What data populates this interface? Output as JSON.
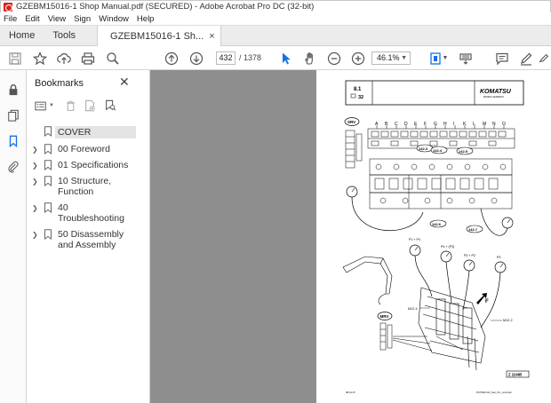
{
  "window": {
    "title": "GZEBM15016-1 Shop Manual.pdf (SECURED) - Adobe Acrobat Pro DC (32-bit)"
  },
  "menu": [
    "File",
    "Edit",
    "View",
    "Sign",
    "Window",
    "Help"
  ],
  "tabs": {
    "home": "Home",
    "tools": "Tools",
    "document": "GZEBM15016-1 Sh...",
    "close_symbol": "×"
  },
  "toolbar": {
    "page_current": "432",
    "page_total": "/ 1378",
    "zoom": "46.1%"
  },
  "bookmarks": {
    "title": "Bookmarks",
    "close_symbol": "✕",
    "items": [
      {
        "label": "COVER",
        "expandable": false,
        "selected": true
      },
      {
        "label": "00 Foreword",
        "expandable": true
      },
      {
        "label": "01 Specifications",
        "expandable": true
      },
      {
        "label": "10 Structure, Function",
        "expandable": true
      },
      {
        "label": "40 Troubleshooting",
        "expandable": true
      },
      {
        "label": "50 Disassembly and Assembly",
        "expandable": true
      }
    ]
  },
  "page": {
    "section": "8.1",
    "page_no": "32",
    "brand": "KOMATSU",
    "brand_sub": "MINING GERMANY",
    "column_letters": [
      "A",
      "B",
      "C",
      "D",
      "E",
      "F",
      "G",
      "H",
      "I",
      "K",
      "L",
      "M",
      "N",
      "O"
    ],
    "labels": {
      "srv": "SRV",
      "mrv": "MRV",
      "c1": "142.3",
      "c2": "142.4",
      "c3": "142.5",
      "c4": "142.6",
      "c5": "142.7",
      "p1": "P1 + P4",
      "p2": "P4 + (P3)",
      "p3": "P3 + P2",
      "p4": "P3",
      "m1": "M12.4",
      "m2": "M12.2",
      "f": "F",
      "code": "Z 22485",
      "footer_left": "08.12.07",
      "footer_right": "PC7000-6-D_Sec_8-1_rev0.doc"
    }
  },
  "colors": {
    "accent": "#1473e6",
    "acrobat_red": "#d9251d",
    "doc_bg": "#8e8e8e"
  }
}
